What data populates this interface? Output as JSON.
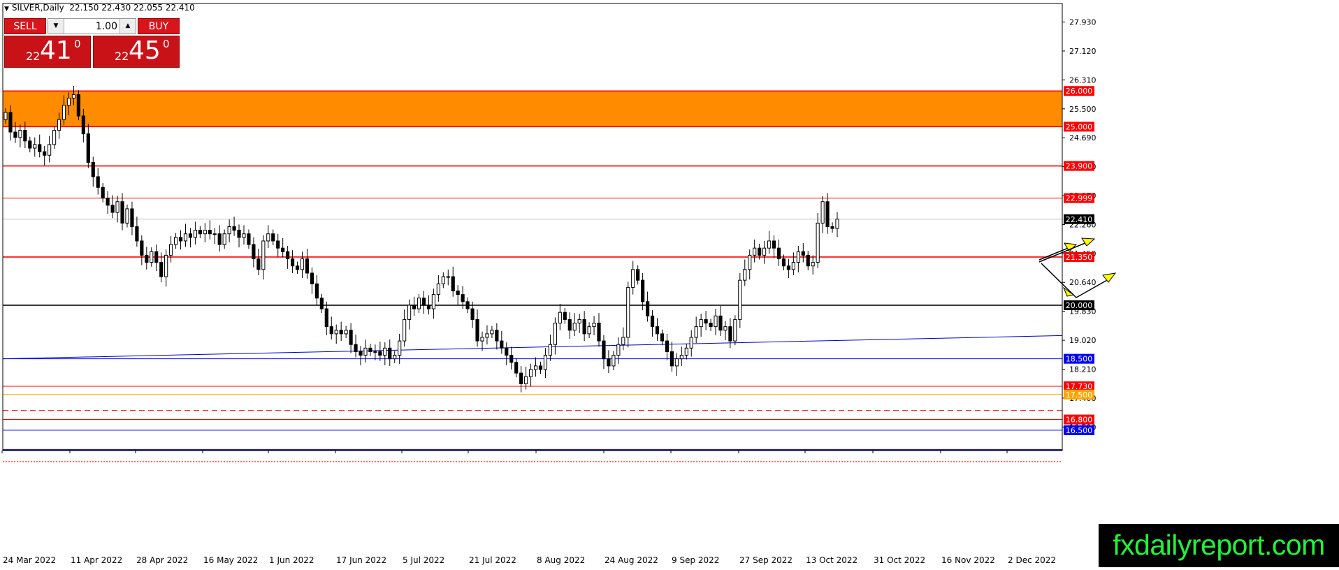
{
  "header": {
    "symbol": "SILVER,Daily",
    "ohlc": "22.150 22.430 22.055 22.410"
  },
  "trade_panel": {
    "sell_label": "SELL",
    "buy_label": "BUY",
    "quantity": "1.00",
    "down_arrow": "▼",
    "up_arrow": "▲",
    "sell_price": {
      "prefix": "22",
      "big": "41",
      "sup": "0"
    },
    "buy_price": {
      "prefix": "22",
      "big": "45",
      "sup": "0"
    }
  },
  "watermark": "fxdailyreport.com",
  "icons": {
    "collapse": "triangle-down-icon"
  },
  "chart_data": {
    "type": "candlestick",
    "symbol": "SILVER",
    "timeframe": "Daily",
    "ylim": [
      16.0,
      28.6
    ],
    "y_ticks": [
      "27.930",
      "27.120",
      "26.310",
      "25.500",
      "24.690",
      "23.880",
      "23.070",
      "22.260",
      "21.450",
      "20.640",
      "19.830",
      "19.020",
      "18.210",
      "17.400",
      "16.590"
    ],
    "x_labels": [
      "24 Mar 2022",
      "11 Apr 2022",
      "28 Apr 2022",
      "16 May 2022",
      "1 Jun 2022",
      "17 Jun 2022",
      "5 Jul 2022",
      "21 Jul 2022",
      "8 Aug 2022",
      "24 Aug 2022",
      "9 Sep 2022",
      "27 Sep 2022",
      "13 Oct 2022",
      "31 Oct 2022",
      "16 Nov 2022",
      "2 Dec 2022"
    ],
    "closes": [
      25.4,
      24.85,
      24.7,
      24.9,
      24.6,
      24.4,
      24.5,
      24.3,
      24.2,
      24.5,
      24.9,
      25.2,
      25.6,
      25.8,
      25.9,
      25.3,
      24.8,
      24.0,
      23.6,
      23.3,
      23.0,
      22.8,
      22.6,
      22.9,
      22.3,
      22.7,
      22.2,
      21.8,
      21.4,
      21.2,
      21.5,
      21.2,
      20.8,
      21.4,
      21.7,
      21.9,
      21.8,
      22.0,
      21.9,
      22.1,
      22.0,
      22.1,
      22.0,
      22.0,
      21.7,
      22.0,
      22.2,
      22.1,
      21.9,
      22.0,
      21.7,
      21.3,
      21.0,
      21.8,
      22.0,
      21.8,
      21.6,
      21.5,
      21.3,
      21.1,
      21.0,
      21.3,
      20.9,
      20.6,
      20.2,
      19.9,
      19.4,
      19.2,
      19.3,
      19.2,
      19.3,
      18.9,
      18.7,
      18.6,
      18.8,
      18.7,
      18.7,
      18.6,
      18.8,
      18.5,
      18.6,
      19.0,
      19.6,
      20.0,
      19.9,
      20.2,
      20.0,
      19.9,
      20.3,
      20.6,
      20.8,
      20.8,
      20.4,
      20.3,
      20.1,
      19.9,
      19.6,
      19.0,
      19.1,
      19.2,
      19.3,
      19.0,
      18.8,
      18.6,
      18.4,
      18.1,
      17.8,
      18.0,
      18.2,
      18.3,
      18.2,
      18.6,
      18.9,
      19.5,
      19.8,
      19.6,
      19.3,
      19.5,
      19.6,
      19.2,
      19.4,
      19.5,
      19.0,
      18.5,
      18.3,
      18.6,
      18.9,
      19.1,
      20.5,
      21.0,
      20.7,
      20.1,
      19.7,
      19.4,
      19.2,
      19.0,
      18.7,
      18.3,
      18.5,
      18.6,
      18.8,
      19.1,
      19.4,
      19.6,
      19.5,
      19.4,
      19.7,
      19.3,
      19.4,
      19.0,
      19.6,
      20.7,
      21.0,
      21.4,
      21.6,
      21.4,
      21.6,
      21.8,
      21.6,
      21.3,
      21.1,
      21.0,
      21.2,
      21.5,
      21.4,
      21.1,
      21.2,
      22.3,
      22.9,
      22.2,
      22.15,
      22.41
    ],
    "levels": [
      {
        "value": 26.0,
        "label": "26.000",
        "color": "#ff0000"
      },
      {
        "value": 25.0,
        "label": "25.000",
        "color": "#ff0000"
      },
      {
        "value": 23.9,
        "label": "23.900",
        "color": "#ff0000"
      },
      {
        "value": 22.999,
        "label": "22.999",
        "color": "#ff0000"
      },
      {
        "value": 22.41,
        "label": "22.410",
        "color": "#000000"
      },
      {
        "value": 21.35,
        "label": "21.350",
        "color": "#ff0000"
      },
      {
        "value": 20.0,
        "label": "20.000",
        "color": "#000000"
      },
      {
        "value": 18.5,
        "label": "18.500",
        "color": "#0000ff"
      },
      {
        "value": 17.73,
        "label": "17.730",
        "color": "#ff0000"
      },
      {
        "value": 17.5,
        "label": "17.500",
        "color": "#ffa500"
      },
      {
        "value": 16.8,
        "label": "16.800",
        "color": "#ff0000"
      },
      {
        "value": 16.5,
        "label": "16.500",
        "color": "#0000ff"
      }
    ],
    "zone": {
      "from": 25.0,
      "to": 26.0,
      "color": "#ff8c00"
    },
    "trendline": {
      "from": 18.5,
      "to": 19.15,
      "color": "#0000cd"
    },
    "grid": false,
    "arrow_color": "#ffff00"
  }
}
